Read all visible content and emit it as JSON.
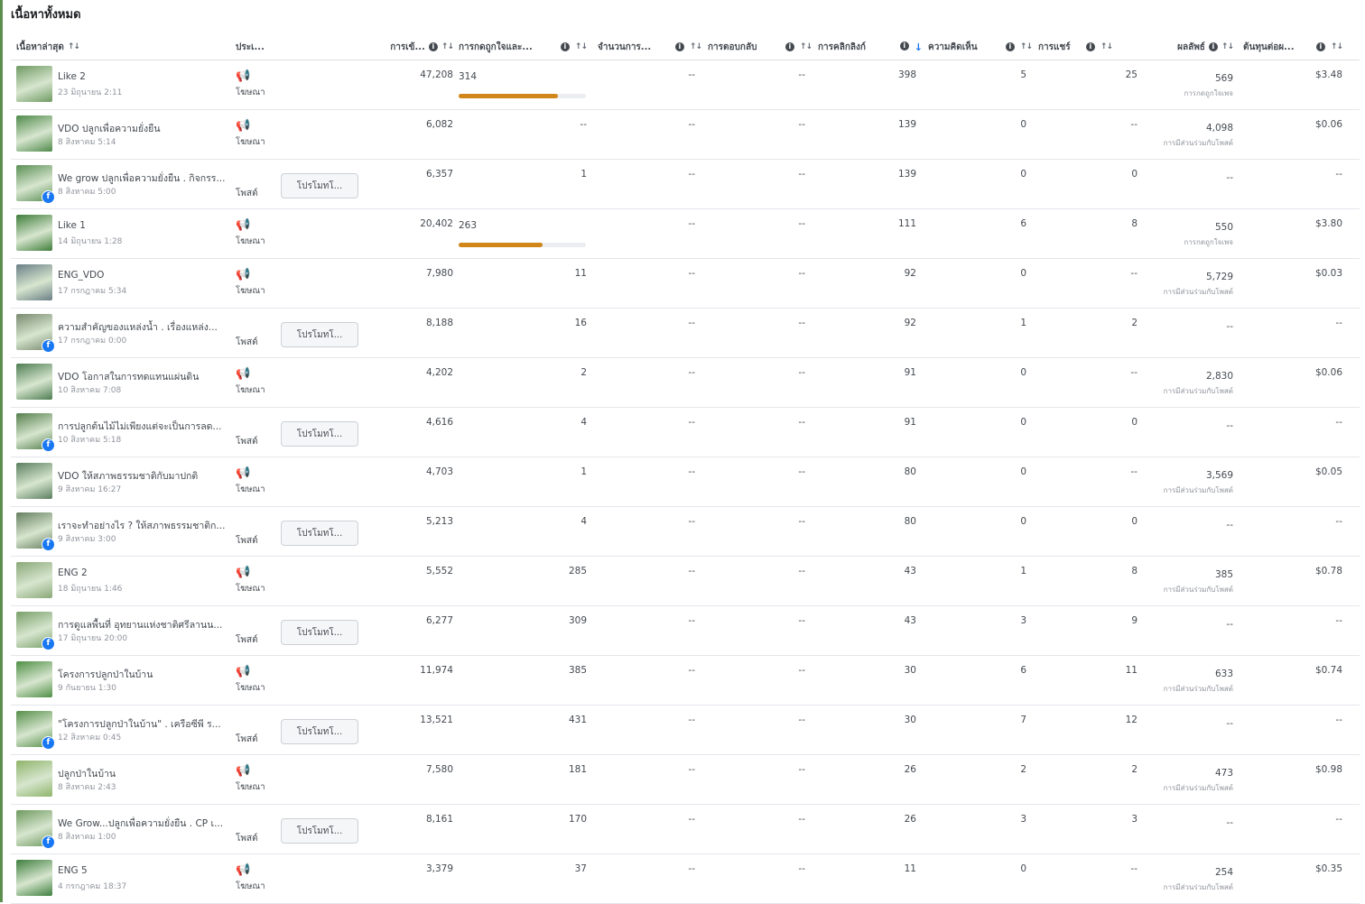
{
  "page_title": "เนื้อหาทั้งหมด",
  "colors": {
    "accent_bar": "#d1861a",
    "link_blue": "#1877f2",
    "left_accent": "#5c8f4e"
  },
  "icons": {
    "info": "info-icon",
    "sort": "sort-icon",
    "sort_active": "arrow-down-icon",
    "ad": "megaphone-icon",
    "platform": "facebook-icon"
  },
  "headers": {
    "content": "เนื้อหาล่าสุด",
    "type": "ประเ...",
    "reach": "การเข้...",
    "engagement": "การกดถูกใจและ...",
    "col3": "จำนวนการ...",
    "col4": "การตอบกลับ",
    "clicks": "การคลิกลิงก์",
    "comments": "ความคิดเห็น",
    "shares": "การแชร์",
    "results": "ผลลัพธ์",
    "cost": "ต้นทุนต่อผ..."
  },
  "sort_symbol": "↑↓",
  "sort_active_symbol": "↓",
  "info_symbol": "i",
  "ad_symbol": "📢",
  "fb_symbol": "f",
  "rows": [
    {
      "title": "Like 2",
      "date": "23 มิถุนายน 2:11",
      "kind": "ad",
      "type_label": "โฆษณา",
      "promote": "",
      "reach": "47,208",
      "engagement": "314",
      "bar": 0.78,
      "col3": "--",
      "col4": "--",
      "clicks": "398",
      "comments": "5",
      "shares": "25",
      "results": "569",
      "results_label": "การกดถูกใจเพจ",
      "cost": "$3.48",
      "fb": false,
      "thumb": "#6f9a62"
    },
    {
      "title": "VDO ปลูกเพื่อความยั่งยืน",
      "date": "8 สิงหาคม 5:14",
      "kind": "ad",
      "type_label": "โฆษณา",
      "promote": "",
      "reach": "6,082",
      "engagement": "--",
      "bar": null,
      "col3": "--",
      "col4": "--",
      "clicks": "139",
      "comments": "0",
      "shares": "--",
      "results": "4,098",
      "results_label": "การมีส่วนร่วมกับโพสต์",
      "cost": "$0.06",
      "fb": false,
      "thumb": "#4f8a4a"
    },
    {
      "title": "We grow ปลูกเพื่อความยั่งยืน . กิจกรร...",
      "date": "8 สิงหาคม 5:00",
      "kind": "post",
      "type_label": "โพสต์",
      "promote": "โปรโมทโ...",
      "reach": "6,357",
      "engagement": "1",
      "bar": null,
      "col3": "--",
      "col4": "--",
      "clicks": "139",
      "comments": "0",
      "shares": "0",
      "results": "--",
      "results_label": "",
      "cost": "--",
      "fb": true,
      "thumb": "#5a8f55"
    },
    {
      "title": "Like 1",
      "date": "14 มิถุนายน 1:28",
      "kind": "ad",
      "type_label": "โฆษณา",
      "promote": "",
      "reach": "20,402",
      "engagement": "263",
      "bar": 0.66,
      "col3": "--",
      "col4": "--",
      "clicks": "111",
      "comments": "6",
      "shares": "8",
      "results": "550",
      "results_label": "การกดถูกใจเพจ",
      "cost": "$3.80",
      "fb": false,
      "thumb": "#3f7d3a"
    },
    {
      "title": "ENG_VDO",
      "date": "17 กรกฎาคม 5:34",
      "kind": "ad",
      "type_label": "โฆษณา",
      "promote": "",
      "reach": "7,980",
      "engagement": "11",
      "bar": null,
      "col3": "--",
      "col4": "--",
      "clicks": "92",
      "comments": "0",
      "shares": "--",
      "results": "5,729",
      "results_label": "การมีส่วนร่วมกับโพสต์",
      "cost": "$0.03",
      "fb": false,
      "thumb": "#6a7f86"
    },
    {
      "title": "ความสำคัญของแหล่งน้ำ . เรื่องแหล่ง...",
      "date": "17 กรกฎาคม 0:00",
      "kind": "post",
      "type_label": "โพสต์",
      "promote": "โปรโมทโ...",
      "reach": "8,188",
      "engagement": "16",
      "bar": null,
      "col3": "--",
      "col4": "--",
      "clicks": "92",
      "comments": "1",
      "shares": "2",
      "results": "--",
      "results_label": "",
      "cost": "--",
      "fb": true,
      "thumb": "#7a8a70"
    },
    {
      "title": "VDO โอกาสในการทดแทนแผ่นดิน",
      "date": "10 สิงหาคม 7:08",
      "kind": "ad",
      "type_label": "โฆษณา",
      "promote": "",
      "reach": "4,202",
      "engagement": "2",
      "bar": null,
      "col3": "--",
      "col4": "--",
      "clicks": "91",
      "comments": "0",
      "shares": "--",
      "results": "2,830",
      "results_label": "การมีส่วนร่วมกับโพสต์",
      "cost": "$0.06",
      "fb": false,
      "thumb": "#4e7d52"
    },
    {
      "title": "การปลูกต้นไม้ไม่เพียงแต่จะเป็นการลด...",
      "date": "10 สิงหาคม 5:18",
      "kind": "post",
      "type_label": "โพสต์",
      "promote": "โปรโมทโ...",
      "reach": "4,616",
      "engagement": "4",
      "bar": null,
      "col3": "--",
      "col4": "--",
      "clicks": "91",
      "comments": "0",
      "shares": "0",
      "results": "--",
      "results_label": "",
      "cost": "--",
      "fb": true,
      "thumb": "#557f4d"
    },
    {
      "title": "VDO ให้สภาพธรรมชาติกับมาปกติ",
      "date": "9 สิงหาคม 16:27",
      "kind": "ad",
      "type_label": "โฆษณา",
      "promote": "",
      "reach": "4,703",
      "engagement": "1",
      "bar": null,
      "col3": "--",
      "col4": "--",
      "clicks": "80",
      "comments": "0",
      "shares": "--",
      "results": "3,569",
      "results_label": "การมีส่วนร่วมกับโพสต์",
      "cost": "$0.05",
      "fb": false,
      "thumb": "#5b7f60"
    },
    {
      "title": "เราจะทำอย่างไร ? ให้สภาพธรรมชาติก...",
      "date": "9 สิงหาคม 3:00",
      "kind": "post",
      "type_label": "โพสต์",
      "promote": "โปรโมทโ...",
      "reach": "5,213",
      "engagement": "4",
      "bar": null,
      "col3": "--",
      "col4": "--",
      "clicks": "80",
      "comments": "0",
      "shares": "0",
      "results": "--",
      "results_label": "",
      "cost": "--",
      "fb": true,
      "thumb": "#667f60"
    },
    {
      "title": "ENG 2",
      "date": "18 มิถุนายน 1:46",
      "kind": "ad",
      "type_label": "โฆษณา",
      "promote": "",
      "reach": "5,552",
      "engagement": "285",
      "bar": null,
      "col3": "--",
      "col4": "--",
      "clicks": "43",
      "comments": "1",
      "shares": "8",
      "results": "385",
      "results_label": "การมีส่วนร่วมกับโพสต์",
      "cost": "$0.78",
      "fb": false,
      "thumb": "#8aa878"
    },
    {
      "title": "การดูแลพื้นที่ อุทยานแห่งชาติศรีลานน...",
      "date": "17 มิถุนายน 20:00",
      "kind": "post",
      "type_label": "โพสต์",
      "promote": "โปรโมทโ...",
      "reach": "6,277",
      "engagement": "309",
      "bar": null,
      "col3": "--",
      "col4": "--",
      "clicks": "43",
      "comments": "3",
      "shares": "9",
      "results": "--",
      "results_label": "",
      "cost": "--",
      "fb": true,
      "thumb": "#79a06a"
    },
    {
      "title": "โครงการปลูกป่าในบ้าน",
      "date": "9 กันยายน 1:30",
      "kind": "ad",
      "type_label": "โฆษณา",
      "promote": "",
      "reach": "11,974",
      "engagement": "385",
      "bar": null,
      "col3": "--",
      "col4": "--",
      "clicks": "30",
      "comments": "6",
      "shares": "11",
      "results": "633",
      "results_label": "การมีส่วนร่วมกับโพสต์",
      "cost": "$0.74",
      "fb": false,
      "thumb": "#4f8f45"
    },
    {
      "title": "\"โครงการปลูกป่าในบ้าน\" . เครือซีพี ร...",
      "date": "12 สิงหาคม 0:45",
      "kind": "post",
      "type_label": "โพสต์",
      "promote": "โปรโมทโ...",
      "reach": "13,521",
      "engagement": "431",
      "bar": null,
      "col3": "--",
      "col4": "--",
      "clicks": "30",
      "comments": "7",
      "shares": "12",
      "results": "--",
      "results_label": "",
      "cost": "--",
      "fb": true,
      "thumb": "#568f4a"
    },
    {
      "title": "ปลูกป่าในบ้าน",
      "date": "8 สิงหาคม 2:43",
      "kind": "ad",
      "type_label": "โฆษณา",
      "promote": "",
      "reach": "7,580",
      "engagement": "181",
      "bar": null,
      "col3": "--",
      "col4": "--",
      "clicks": "26",
      "comments": "2",
      "shares": "2",
      "results": "473",
      "results_label": "การมีส่วนร่วมกับโพสต์",
      "cost": "$0.98",
      "fb": false,
      "thumb": "#8fb46a"
    },
    {
      "title": "We Grow...ปลูกเพื่อความยั่งยืน . CP เ...",
      "date": "8 สิงหาคม 1:00",
      "kind": "post",
      "type_label": "โพสต์",
      "promote": "โปรโมทโ...",
      "reach": "8,161",
      "engagement": "170",
      "bar": null,
      "col3": "--",
      "col4": "--",
      "clicks": "26",
      "comments": "3",
      "shares": "3",
      "results": "--",
      "results_label": "",
      "cost": "--",
      "fb": true,
      "thumb": "#6f9a5f"
    },
    {
      "title": "ENG 5",
      "date": "4 กรกฎาคม 18:37",
      "kind": "ad",
      "type_label": "โฆษณา",
      "promote": "",
      "reach": "3,379",
      "engagement": "37",
      "bar": null,
      "col3": "--",
      "col4": "--",
      "clicks": "11",
      "comments": "0",
      "shares": "--",
      "results": "254",
      "results_label": "การมีส่วนร่วมกับโพสต์",
      "cost": "$0.35",
      "fb": false,
      "thumb": "#3f7f3f"
    }
  ]
}
